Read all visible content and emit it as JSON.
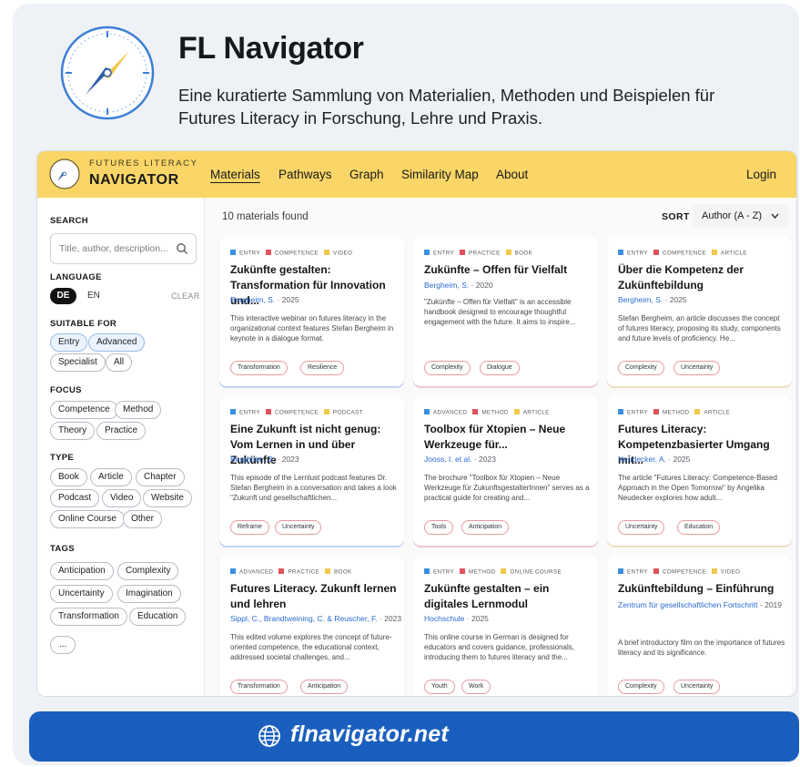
{
  "hero": {
    "title": "FL Navigator",
    "subtitle": "Eine kuratierte Sammlung von Materialien, Methoden und Beispielen für Futures Literacy in Forschung, Lehre und Praxis."
  },
  "nav": {
    "brand_top": "FUTURES LITERACY",
    "brand_main": "NAVIGATOR",
    "links": [
      "Materials",
      "Pathways",
      "Graph",
      "Similarity Map",
      "About"
    ],
    "active": "Materials",
    "login": "Login"
  },
  "sidebar": {
    "search_label": "SEARCH",
    "search_placeholder": "Title, author, description...",
    "language_label": "LANGUAGE",
    "languages": [
      "DE",
      "EN"
    ],
    "selected_language": "DE",
    "clear": "CLEAR",
    "suitable_label": "SUITABLE FOR",
    "suitable": [
      "Entry",
      "Advanced",
      "Specialist",
      "All"
    ],
    "focus_label": "FOCUS",
    "focus": [
      "Competence",
      "Method",
      "Theory",
      "Practice"
    ],
    "type_label": "TYPE",
    "types": [
      "Book",
      "Article",
      "Chapter",
      "Podcast",
      "Video",
      "Website",
      "Online Course",
      "Other"
    ],
    "tags_label": "TAGS",
    "tags": [
      "Anticipation",
      "Complexity",
      "Uncertainty",
      "Imagination",
      "Transformation",
      "Education"
    ],
    "more": "..."
  },
  "main": {
    "count": "10 materials found",
    "sort_label": "SORT",
    "sort_value": "Author (A - Z)"
  },
  "colors": {
    "level": "#3a8fe0",
    "focus": "#e0525c",
    "type": "#f1c84a",
    "nav_bg": "#f9d667",
    "footer_bg": "#1a5fbe",
    "author_link": "#2a6bd1"
  },
  "cards": [
    {
      "level": "ENTRY",
      "focus": "COMPETENCE",
      "type": "VIDEO",
      "title": "Zukünfte gestalten: Transformation für Innovation und...",
      "author": "Bergheim, S.",
      "year": "2025",
      "desc": "This interactive webinar on futures literacy in the organizational context features Stefan Bergheim in keynote in a dialogue format.",
      "tags": [
        "Transformation",
        "Resilience"
      ]
    },
    {
      "level": "ENTRY",
      "focus": "PRACTICE",
      "type": "BOOK",
      "title": "Zukünfte – Offen für Vielfalt",
      "author": "Bergheim, S.",
      "year": "2020",
      "desc": "\"Zukünfte – Offen für Vielfalt\" is an accessible handbook designed to encourage thoughtful engagement with the future. It aims to inspire...",
      "tags": [
        "Complexity",
        "Dialogue"
      ]
    },
    {
      "level": "ENTRY",
      "focus": "COMPETENCE",
      "type": "ARTICLE",
      "title": "Über die Kompetenz der Zukünftebildung",
      "author": "Bergheim, S.",
      "year": "2025",
      "desc": "Stefan Bergheim, an article discusses the concept of futures literacy, proposing its study, components and future levels of proficiency. He...",
      "tags": [
        "Complexity",
        "Uncertainty"
      ]
    },
    {
      "level": "ENTRY",
      "focus": "COMPETENCE",
      "type": "PODCAST",
      "title": "Eine Zukunft ist nicht genug: Vom Lernen in und über Zukünfte",
      "author": "Bergheim, S.",
      "year": "2023",
      "desc": "This episode of the Lernlust podcast features Dr. Stefan Bergheim in a conversation and takes a look \"Zukunft und gesellschaftlichen...",
      "tags": [
        "Reframe",
        "Uncertainty"
      ]
    },
    {
      "level": "ADVANCED",
      "focus": "METHOD",
      "type": "ARTICLE",
      "title": "Toolbox für Xtopien – Neue Werkzeuge für...",
      "author": "Jooss, I. et al.",
      "year": "2023",
      "desc": "The brochure \"Toolbox für Xtopien – Neue Werkzeuge für ZukunftsgestalterInnen\" serves as a practical guide for creating and...",
      "tags": [
        "Tools",
        "Anticipation"
      ]
    },
    {
      "level": "ENTRY",
      "focus": "METHOD",
      "type": "ARTICLE",
      "title": "Futures Literacy: Kompetenzbasierter Umgang mit...",
      "author": "Neudecker, A.",
      "year": "2025",
      "desc": "The article \"Futures Literacy: Competence-Based Approach in the Open Tomorrow\" by Angelika Neudecker explores how adult...",
      "tags": [
        "Uncertainty",
        "Education"
      ]
    },
    {
      "level": "ADVANCED",
      "focus": "PRACTICE",
      "type": "BOOK",
      "title": "Futures Literacy. Zukunft lernen und lehren",
      "author": "Sippl, C., Brandtweining, C. & Reuscher, F.",
      "year": "2023",
      "desc": "This edited volume explores the concept of future-oriented competence, the educational context, addressed societal challenges, and...",
      "tags": [
        "Transformation",
        "Anticipation"
      ]
    },
    {
      "level": "ENTRY",
      "focus": "METHOD",
      "type": "ONLINE COURSE",
      "title": "Zukünfte gestalten – ein digitales Lernmodul",
      "author": "Hochschule",
      "year": "2025",
      "desc": "This online course in German is designed for educators and covers guidance, professionals, introducing them to futures literacy and the...",
      "tags": [
        "Youth",
        "Work"
      ]
    },
    {
      "level": "ENTRY",
      "focus": "COMPETENCE",
      "type": "VIDEO",
      "title": "Zukünftebildung – Einführung",
      "author": "Zentrum für gesellschaftlichen Fortschritt",
      "year": "2019",
      "desc": "A brief introductory film on the importance of futures literacy and its significance.",
      "tags": [
        "Complexity",
        "Uncertainty"
      ]
    }
  ],
  "footer": {
    "text": "flnavigator.net"
  }
}
